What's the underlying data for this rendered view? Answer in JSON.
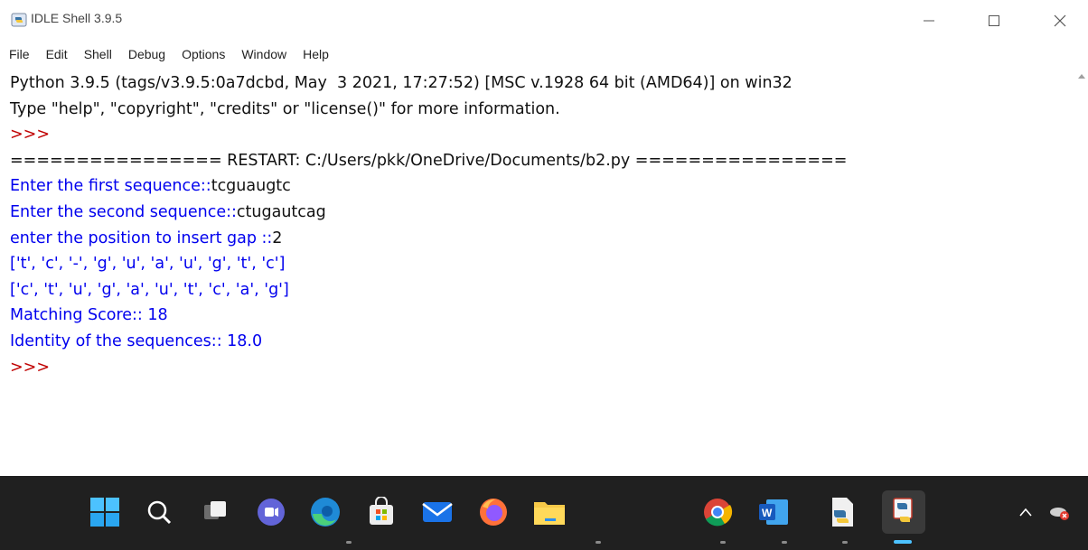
{
  "window": {
    "title": "IDLE Shell 3.9.5"
  },
  "menu": [
    "File",
    "Edit",
    "Shell",
    "Debug",
    "Options",
    "Window",
    "Help"
  ],
  "shell": {
    "lines": [
      {
        "segments": [
          {
            "text": "Python 3.9.5 (tags/v3.9.5:0a7dcbd, May  3 2021, 17:27:52) [MSC v.1928 64 bit (AMD64)] on win32",
            "color": "black"
          }
        ]
      },
      {
        "segments": [
          {
            "text": "Type \"help\", \"copyright\", \"credits\" or \"license()\" for more information.",
            "color": "black"
          }
        ]
      },
      {
        "segments": [
          {
            "text": ">>> ",
            "color": "red"
          }
        ]
      },
      {
        "segments": [
          {
            "text": "================ RESTART: C:/Users/pkk/OneDrive/Documents/b2.py ================",
            "color": "black"
          }
        ]
      },
      {
        "segments": [
          {
            "text": "Enter the first sequence::",
            "color": "blue"
          },
          {
            "text": "tcguaugtc",
            "color": "black"
          }
        ]
      },
      {
        "segments": [
          {
            "text": "Enter the second sequence::",
            "color": "blue"
          },
          {
            "text": "ctugautcag",
            "color": "black"
          }
        ]
      },
      {
        "segments": [
          {
            "text": "enter the position to insert gap ::",
            "color": "blue"
          },
          {
            "text": "2",
            "color": "black"
          }
        ]
      },
      {
        "segments": [
          {
            "text": "['t', 'c', '-', 'g', 'u', 'a', 'u', 'g', 't', 'c']",
            "color": "blue"
          }
        ]
      },
      {
        "segments": [
          {
            "text": "['c', 't', 'u', 'g', 'a', 'u', 't', 'c', 'a', 'g']",
            "color": "blue"
          }
        ]
      },
      {
        "segments": [
          {
            "text": "Matching Score:: 18",
            "color": "blue"
          }
        ]
      },
      {
        "segments": [
          {
            "text": "Identity of the sequences:: 18.0",
            "color": "blue"
          }
        ]
      },
      {
        "segments": [
          {
            "text": ">>> ",
            "color": "red"
          }
        ]
      }
    ]
  },
  "colors": {
    "prompt": "#c00000",
    "stdout": "#0000ee",
    "text": "#111111",
    "taskbar": "#202020",
    "active_indicator": "#4cc2ff"
  },
  "taskbar": {
    "icons": [
      {
        "name": "windows-start-icon"
      },
      {
        "name": "search-icon"
      },
      {
        "name": "task-view-icon"
      },
      {
        "name": "teams-chat-icon"
      },
      {
        "name": "edge-browser-icon"
      },
      {
        "name": "microsoft-store-icon"
      },
      {
        "name": "mail-icon"
      },
      {
        "name": "firefox-icon"
      },
      {
        "name": "file-explorer-icon"
      },
      {
        "name": "chrome-icon"
      },
      {
        "name": "word-icon"
      },
      {
        "name": "python-file-icon"
      },
      {
        "name": "idle-python-icon"
      }
    ],
    "tray": [
      "chevron-up-icon",
      "onedrive-error-icon"
    ]
  }
}
